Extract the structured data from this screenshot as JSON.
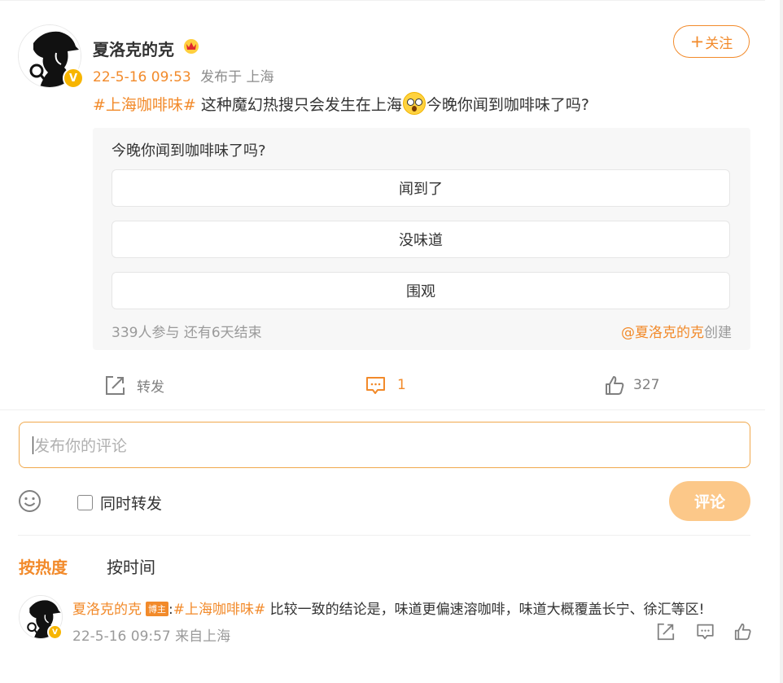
{
  "post": {
    "author": "夏洛克的克",
    "time": "22-5-16 09:53",
    "location": "发布于 上海",
    "follow_label": "关注",
    "follow_plus": "+",
    "hashtag": "#上海咖啡味#",
    "text_before_emoji": " 这种魔幻热搜只会发生在上海",
    "text_after_emoji": "今晚你闻到咖啡味了吗?"
  },
  "poll": {
    "question": "今晚你闻到咖啡味了吗?",
    "options": [
      "闻到了",
      "没味道",
      "围观"
    ],
    "participants": "339人参与 还有6天结束",
    "creator_link": "@夏洛克的克",
    "creator_suffix": "创建"
  },
  "actions": {
    "repost_label": "转发",
    "comment_count": "1",
    "like_count": "327"
  },
  "composer": {
    "placeholder": "发布你的评论",
    "repost_checkbox_label": "同时转发",
    "submit_label": "评论"
  },
  "sort": {
    "by_hot": "按热度",
    "by_time": "按时间"
  },
  "comments": [
    {
      "user": "夏洛克的克",
      "badge": "博主",
      "colon": ":",
      "hashtag": "#上海咖啡味#",
      "text": " 比较一致的结论是，味道更偏速溶咖啡，味道大概覆盖长宁、徐汇等区!",
      "meta": "22-5-16 09:57 来自上海"
    }
  ],
  "icons": {
    "verified": "V",
    "crown": "crown-icon",
    "emoji": "shocked-face-emoji"
  },
  "colors": {
    "accent": "#f28a2a",
    "submit_disabled": "#fcc889",
    "verified_badge": "#f7b500",
    "poll_bg": "#f7f7f7"
  }
}
